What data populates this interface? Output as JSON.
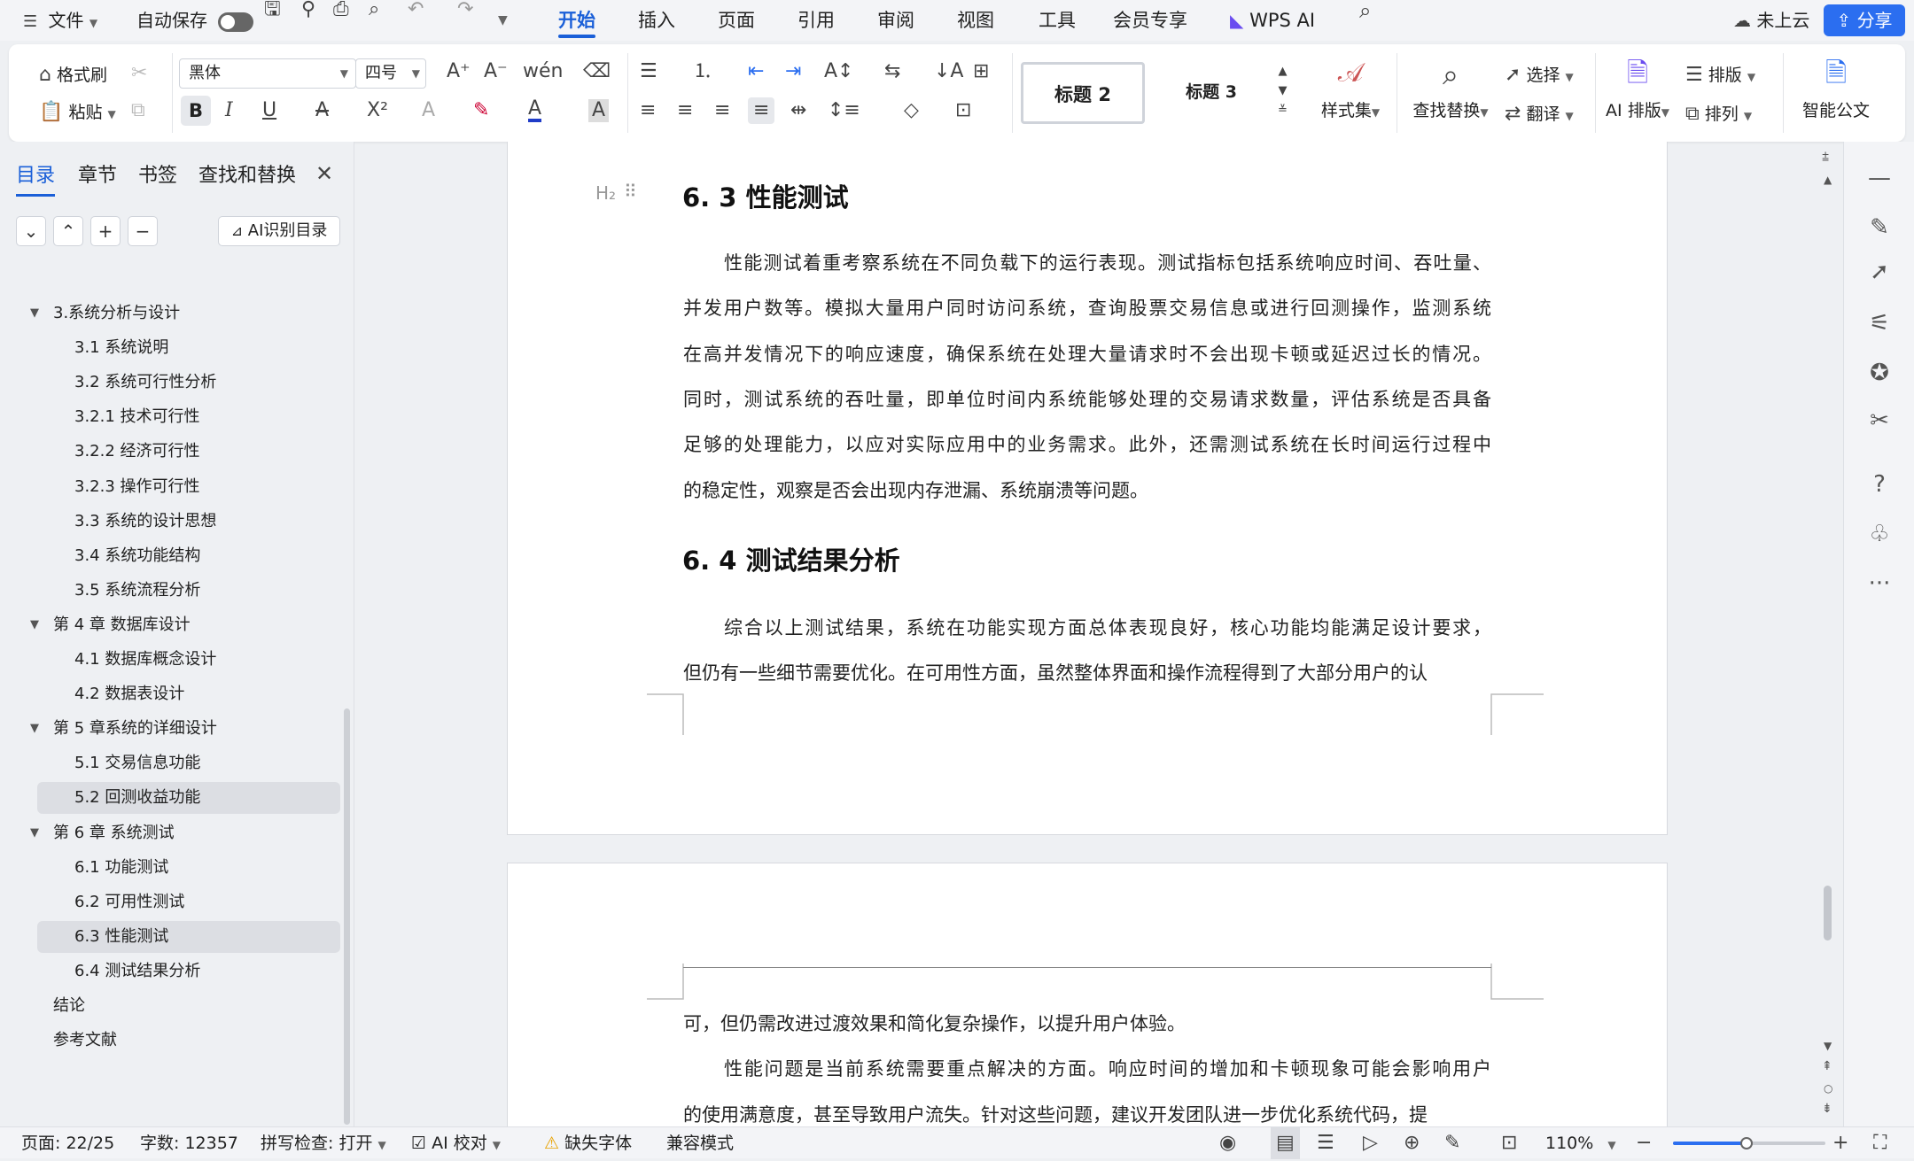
{
  "titlebar": {
    "menu_file": "文件",
    "autosave_label": "自动保存",
    "tabs": [
      "开始",
      "插入",
      "页面",
      "引用",
      "审阅",
      "视图",
      "工具",
      "会员专享",
      "WPS AI"
    ],
    "cloud_status": "未上云",
    "share_label": "分享"
  },
  "ribbon": {
    "format_painter": "格式刷",
    "paste": "粘贴",
    "font_name": "黑体",
    "font_size": "四号",
    "style_h2": "标题 2",
    "style_h3": "标题 3",
    "style_set": "样式集",
    "find_replace": "查找替换",
    "select": "选择",
    "translate": "翻译",
    "ai_layout": "AI 排版",
    "layout": "排版",
    "arrange": "排列",
    "smart_doc": "智能公文"
  },
  "leftpanel": {
    "tabs": [
      "目录",
      "章节",
      "书签",
      "查找和替换"
    ],
    "ai_toc_button": "AI识别目录",
    "toc_items": [
      {
        "label": "3.系统分析与设计",
        "level": 1
      },
      {
        "label": "3.1  系统说明",
        "level": 2
      },
      {
        "label": "3.2  系统可行性分析",
        "level": 2
      },
      {
        "label": "3.2.1  技术可行性",
        "level": 2
      },
      {
        "label": "3.2.2  经济可行性",
        "level": 2
      },
      {
        "label": "3.2.3  操作可行性",
        "level": 2
      },
      {
        "label": "3.3  系统的设计思想",
        "level": 2
      },
      {
        "label": "3.4 系统功能结构",
        "level": 2
      },
      {
        "label": "3.5 系统流程分析",
        "level": 2
      },
      {
        "label": "第 4 章  数据库设计",
        "level": 1
      },
      {
        "label": "4.1 数据库概念设计",
        "level": 2
      },
      {
        "label": "4.2 数据表设计",
        "level": 2
      },
      {
        "label": "第 5 章系统的详细设计",
        "level": 1
      },
      {
        "label": "5.1 交易信息功能",
        "level": 2
      },
      {
        "label": "5.2 回测收益功能",
        "level": 2
      },
      {
        "label": "第 6 章  系统测试",
        "level": 1
      },
      {
        "label": "6.1  功能测试",
        "level": 2
      },
      {
        "label": "6.2  可用性测试",
        "level": 2
      },
      {
        "label": "6.3  性能测试",
        "level": 2
      },
      {
        "label": "6.4  测试结果分析",
        "level": 2
      },
      {
        "label": "结论",
        "level": 0
      },
      {
        "label": "参考文献",
        "level": 0
      }
    ]
  },
  "document": {
    "heading_63": "6. 3  性能测试",
    "p63_lines": [
      "性能测试着重考察系统在不同负载下的运行表现。测试指标包括系统响应时间、吞吐量、",
      "并发用户数等。模拟大量用户同时访问系统，查询股票交易信息或进行回测操作，监测系统",
      "在高并发情况下的响应速度，确保系统在处理大量请求时不会出现卡顿或延迟过长的情况。",
      "同时，测试系统的吞吐量，即单位时间内系统能够处理的交易请求数量，评估系统是否具备",
      "足够的处理能力，以应对实际应用中的业务需求。此外，还需测试系统在长时间运行过程中",
      "的稳定性，观察是否会出现内存泄漏、系统崩溃等问题。"
    ],
    "heading_64": "6. 4  测试结果分析",
    "p64_lines": [
      "综合以上测试结果，系统在功能实现方面总体表现良好，核心功能均能满足设计要求，",
      "但仍有一些细节需要优化。在可用性方面，虽然整体界面和操作流程得到了大部分用户的认"
    ],
    "page2_lines": [
      "可，但仍需改进过渡效果和简化复杂操作，以提升用户体验。",
      "性能问题是当前系统需要重点解决的方面。响应时间的增加和卡顿现象可能会影响用户",
      "的使用满意度，甚至导致用户流失。针对这些问题，建议开发团队进一步优化系统代码，提"
    ]
  },
  "statusbar": {
    "page": "页面: 22/25",
    "words": "字数: 12357",
    "spellcheck": "拼写检查: 打开",
    "ai_proof": "AI 校对",
    "missing_font": "缺失字体",
    "compat_mode": "兼容模式",
    "zoom": "110%"
  },
  "colors": {
    "accent": "#1a5fd8",
    "share": "#2b6ef0",
    "page_bg": "#eef0f3"
  }
}
